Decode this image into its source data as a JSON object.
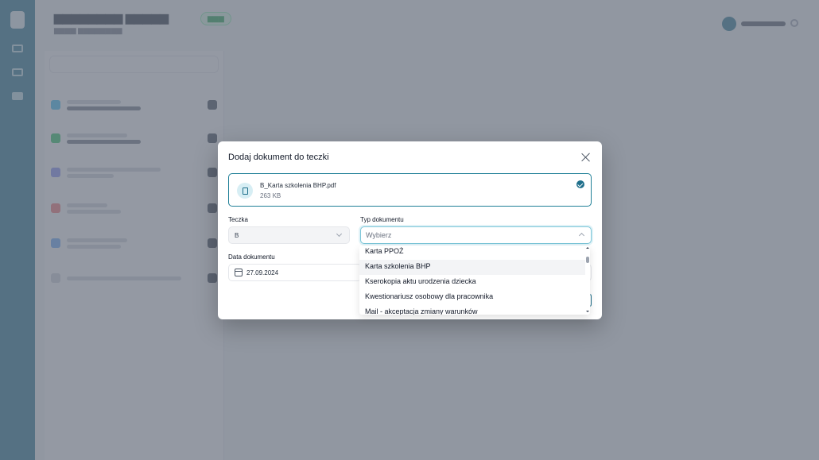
{
  "modal": {
    "title": "Dodaj dokument do teczki",
    "file": {
      "name": "B_Karta szkolenia BHP.pdf",
      "size": "263 KB"
    },
    "folder_label": "Teczka",
    "folder_value": "B",
    "type_label": "Typ dokumentu",
    "type_placeholder": "Wybierz",
    "date_label": "Data dokumentu",
    "date_value": "27.09.2024"
  },
  "dropdown": {
    "options": [
      "Karta PPOŻ",
      "Karta szkolenia BHP",
      "Kserokopia aktu urodzenia dziecka",
      "Kwestionariusz osobowy dla pracownika",
      "Mail - akceptacja zmiany warunków"
    ],
    "highlighted": "Karta szkolenia BHP"
  },
  "colors": {
    "accent": "#1f6f8b",
    "focus_ring": "#7cc6d8"
  },
  "icons": [
    "file-icon",
    "check-circle-icon",
    "close-icon",
    "chevron-down-icon",
    "chevron-up-icon",
    "calendar-icon"
  ]
}
